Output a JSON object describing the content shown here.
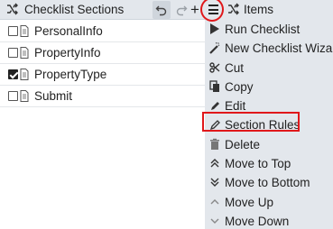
{
  "left": {
    "title": "Checklist Sections",
    "items": [
      {
        "label": "PersonalInfo",
        "checked": false
      },
      {
        "label": "PropertyInfo",
        "checked": false
      },
      {
        "label": "PropertyType",
        "checked": true
      },
      {
        "label": "Submit",
        "checked": false
      }
    ]
  },
  "right": {
    "title": "Items",
    "menu": [
      {
        "label": "Run Checklist",
        "icon": "play-icon"
      },
      {
        "label": "New Checklist Wizard",
        "icon": "wand-icon"
      },
      {
        "label": "Cut",
        "icon": "scissors-icon"
      },
      {
        "label": "Copy",
        "icon": "copy-icon"
      },
      {
        "label": "Edit",
        "icon": "pencil-icon"
      },
      {
        "label": "Section Rules",
        "icon": "pencil-outline-icon",
        "highlighted": true
      },
      {
        "label": "Delete",
        "icon": "trash-icon"
      },
      {
        "label": "Move to Top",
        "icon": "double-chevron-up-icon"
      },
      {
        "label": "Move to Bottom",
        "icon": "double-chevron-down-icon"
      },
      {
        "label": "Move Up",
        "icon": "chevron-up-icon"
      },
      {
        "label": "Move Down",
        "icon": "chevron-down-icon"
      }
    ]
  },
  "colors": {
    "header_bg": "#e3e7ec",
    "annotation_red": "#e0181b"
  }
}
